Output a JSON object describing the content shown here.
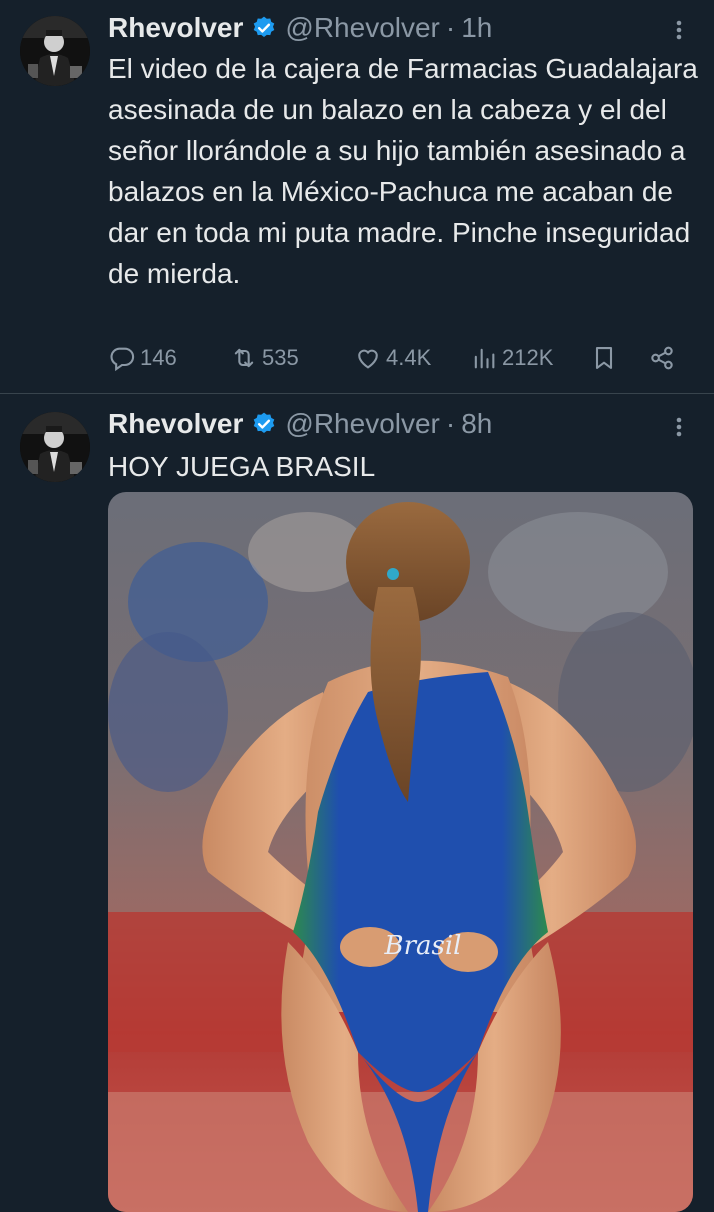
{
  "tweets": [
    {
      "author_name": "Rhevolver",
      "handle": "@Rhevolver",
      "separator": "·",
      "time": "1h",
      "text": "El video de la cajera de Farmacias Guadalajara asesinada de un balazo en la cabeza y el del señor llorándole a su hijo también asesinado a balazos en la México-Pachuca me acaban de dar en toda mi puta madre. Pinche inseguridad de mierda.",
      "stats": {
        "replies": "146",
        "reposts": "535",
        "likes": "4.4K",
        "views": "212K"
      }
    },
    {
      "author_name": "Rhevolver",
      "handle": "@Rhevolver",
      "separator": "·",
      "time": "8h",
      "text": "HOY JUEGA BRASIL",
      "media": {
        "kind": "photo",
        "suit_text": "Brasil"
      }
    }
  ],
  "colors": {
    "background": "#15202b",
    "text": "#e7e9ea",
    "muted": "#8b98a5",
    "verified": "#1d9bf0",
    "divider": "#38444d"
  },
  "icons": [
    "verified-badge-icon",
    "more-icon",
    "reply-icon",
    "repost-icon",
    "like-icon",
    "views-icon",
    "bookmark-icon",
    "share-icon"
  ]
}
